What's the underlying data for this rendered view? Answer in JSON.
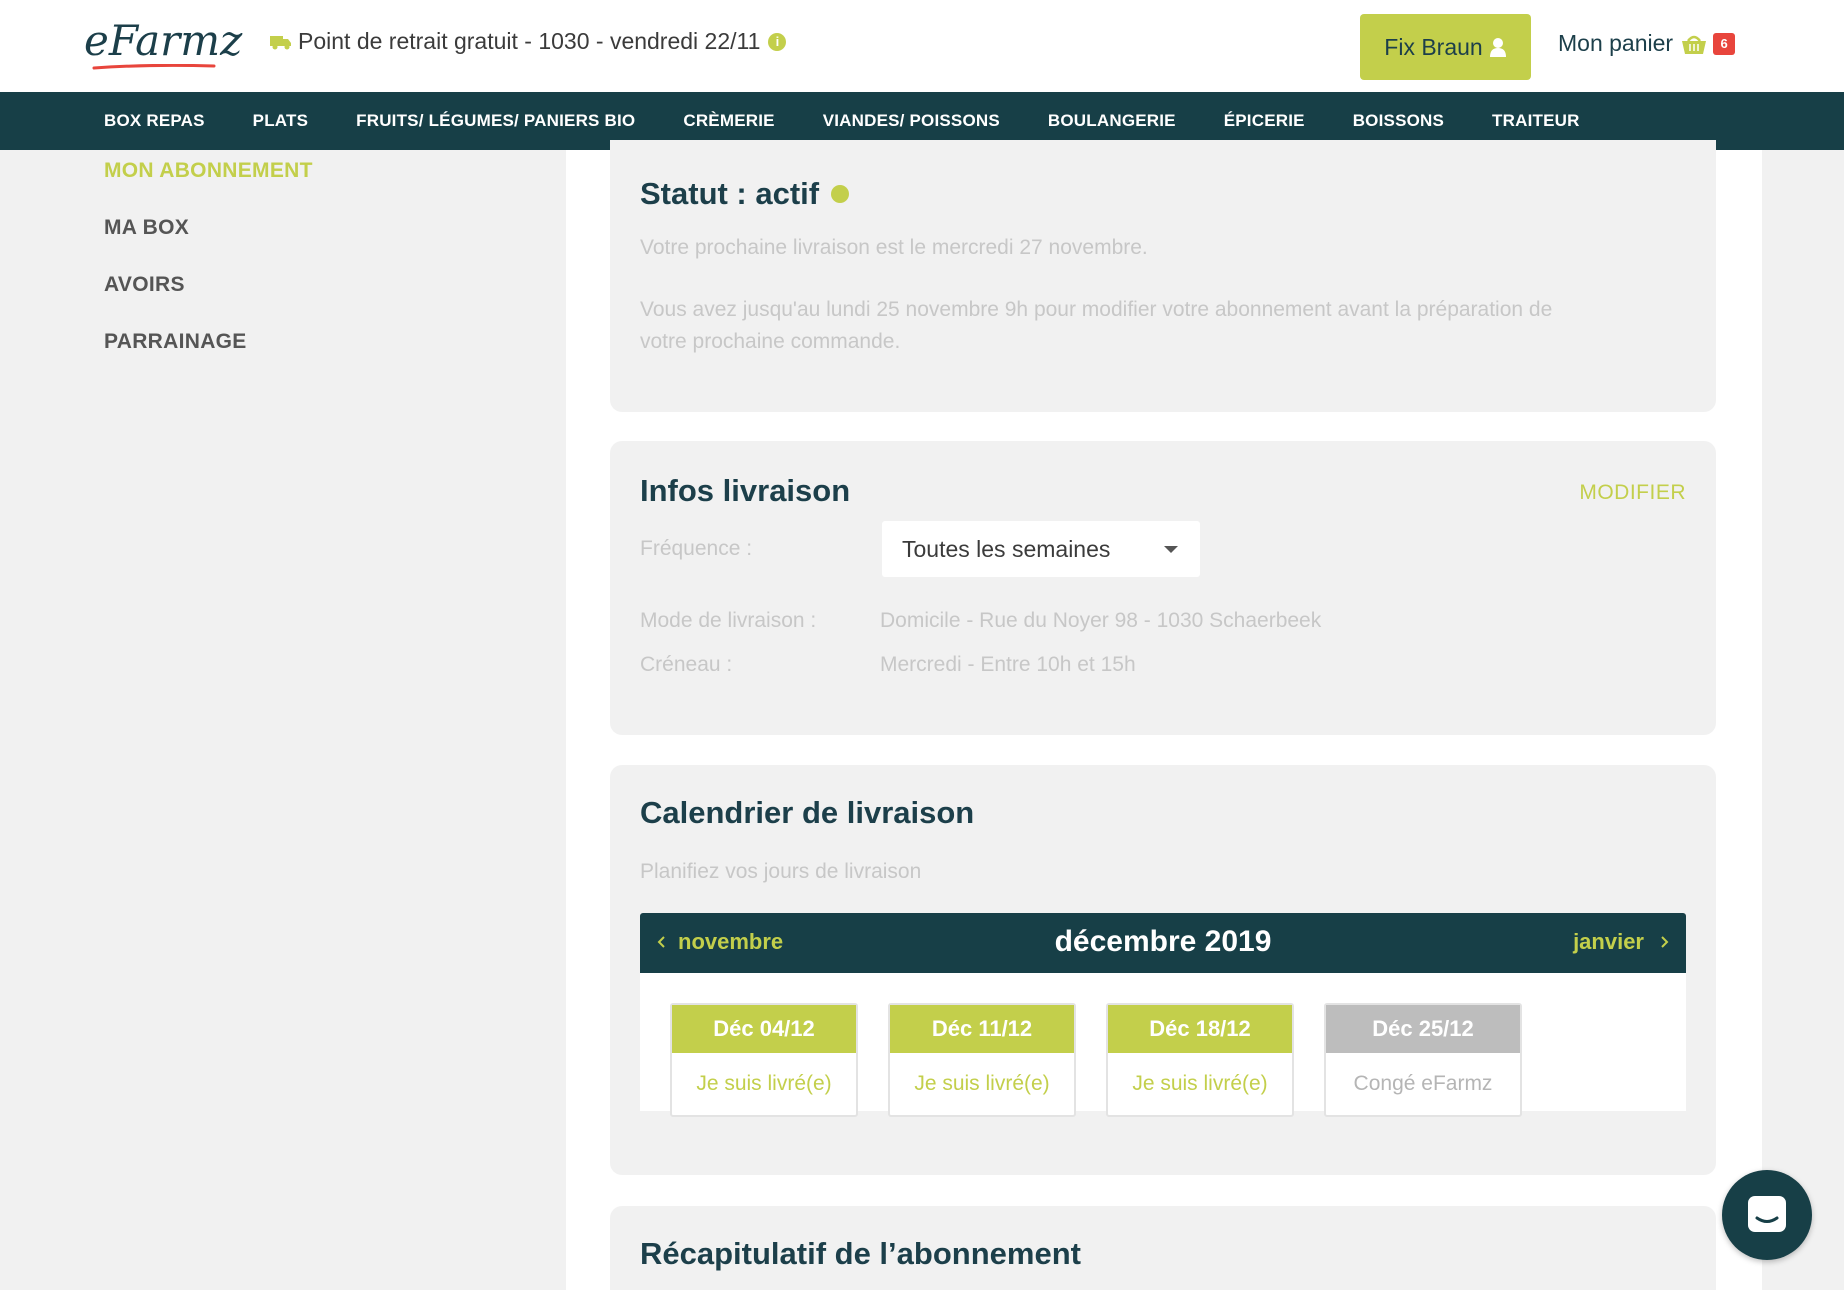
{
  "brand": {
    "logo": "eFarmz",
    "accent": "#c3cf4b",
    "dark": "#173f47",
    "badge_red": "#e8453c"
  },
  "header": {
    "pickup_text": "Point de retrait gratuit - 1030 - vendredi 22/11",
    "user_button": "Fix Braun",
    "cart_label": "Mon panier",
    "cart_count": "6"
  },
  "nav": {
    "items": [
      "BOX REPAS",
      "PLATS",
      "FRUITS/ LÉGUMES/ PANIERS BIO",
      "CRÈMERIE",
      "VIANDES/ POISSONS",
      "BOULANGERIE",
      "ÉPICERIE",
      "BOISSONS",
      "TRAITEUR"
    ]
  },
  "sidebar": {
    "items": [
      {
        "label": "MON ABONNEMENT",
        "active": true
      },
      {
        "label": "MA BOX",
        "active": false
      },
      {
        "label": "AVOIRS",
        "active": false
      },
      {
        "label": "PARRAINAGE",
        "active": false
      }
    ]
  },
  "status": {
    "title": "Statut : actif",
    "line1": "Votre prochaine livraison est le mercredi 27 novembre.",
    "line2": "Vous avez jusqu'au lundi 25 novembre 9h pour modifier votre abonnement avant la préparation de votre prochaine commande."
  },
  "delivery_info": {
    "title": "Infos livraison",
    "modify": "MODIFIER",
    "frequency_label": "Fréquence :",
    "frequency_value": "Toutes les semaines",
    "mode_label": "Mode de livraison :",
    "mode_value": "Domicile - Rue du Noyer 98 - 1030 Schaerbeek",
    "slot_label": "Créneau :",
    "slot_value": "Mercredi - Entre 10h et 15h"
  },
  "calendar": {
    "title": "Calendrier de livraison",
    "subtitle": "Planifiez vos jours de livraison",
    "prev": "novembre",
    "current": "décembre 2019",
    "next": "janvier",
    "days": [
      {
        "date": "Déc 04/12",
        "status": "Je suis livré(e)"
      },
      {
        "date": "Déc 11/12",
        "status": "Je suis livré(e)"
      },
      {
        "date": "Déc 18/12",
        "status": "Je suis livré(e)"
      },
      {
        "date": "Déc 25/12",
        "status": "Congé eFarmz"
      }
    ]
  },
  "recap": {
    "title": "Récapitulatif de l’abonnement"
  },
  "chat": {
    "icon": "chat-icon"
  }
}
